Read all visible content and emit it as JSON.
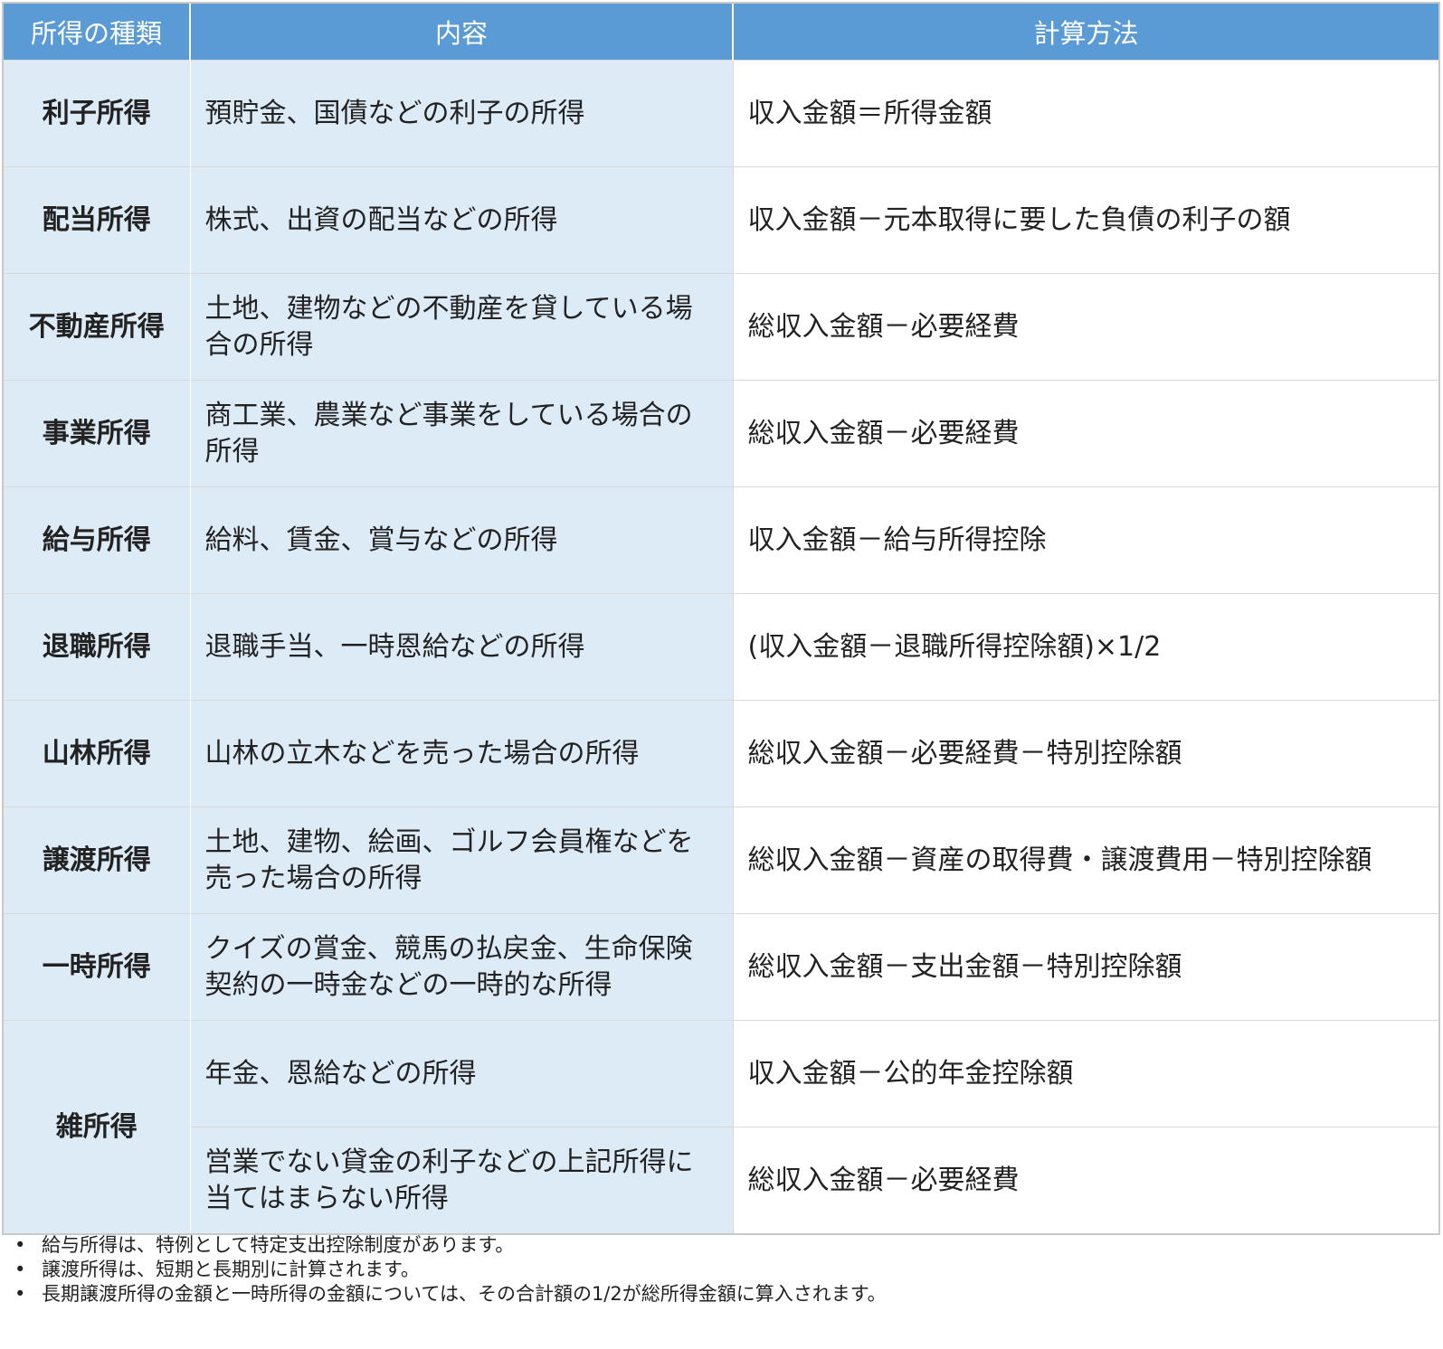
{
  "table": {
    "headers": [
      "所得の種類",
      "内容",
      "計算方法"
    ],
    "rows": [
      {
        "type": "利子所得",
        "content": "預貯金、国債などの利子の所得",
        "method": "収入金額＝所得金額"
      },
      {
        "type": "配当所得",
        "content": "株式、出資の配当などの所得",
        "method": "収入金額－元本取得に要した負債の利子の額"
      },
      {
        "type": "不動産所得",
        "content": "土地、建物などの不動産を貸している場合の所得",
        "method": "総収入金額－必要経費"
      },
      {
        "type": "事業所得",
        "content": "商工業、農業など事業をしている場合の所得",
        "method": "総収入金額－必要経費"
      },
      {
        "type": "給与所得",
        "content": "給料、賃金、賞与などの所得",
        "method": "収入金額－給与所得控除"
      },
      {
        "type": "退職所得",
        "content": "退職手当、一時恩給などの所得",
        "method": "(収入金額－退職所得控除額)×1/2"
      },
      {
        "type": "山林所得",
        "content": "山林の立木などを売った場合の所得",
        "method": "総収入金額－必要経費－特別控除額"
      },
      {
        "type": "譲渡所得",
        "content": "土地、建物、絵画、ゴルフ会員権などを売った場合の所得",
        "method": "総収入金額－資産の取得費・譲渡費用－特別控除額"
      },
      {
        "type": "一時所得",
        "content": "クイズの賞金、競馬の払戻金、生命保険契約の一時金などの一時的な所得",
        "method": "総収入金額－支出金額－特別控除額"
      },
      {
        "type": "雑所得",
        "content": "年金、恩給などの所得",
        "method": "収入金額－公的年金控除額"
      },
      {
        "type": "雑所得",
        "content": "営業でない貸金の利子などの上記所得に当てはまらない所得",
        "method": "総収入金額－必要経費"
      }
    ]
  },
  "notes": {
    "bullet": "•",
    "items": [
      "給与所得は、特例として特定支出控除制度があります。",
      "譲渡所得は、短期と長期別に計算されます。",
      "長期譲渡所得の金額と一時所得の金額については、その合計額の1/2が総所得金額に算入されます。"
    ]
  }
}
